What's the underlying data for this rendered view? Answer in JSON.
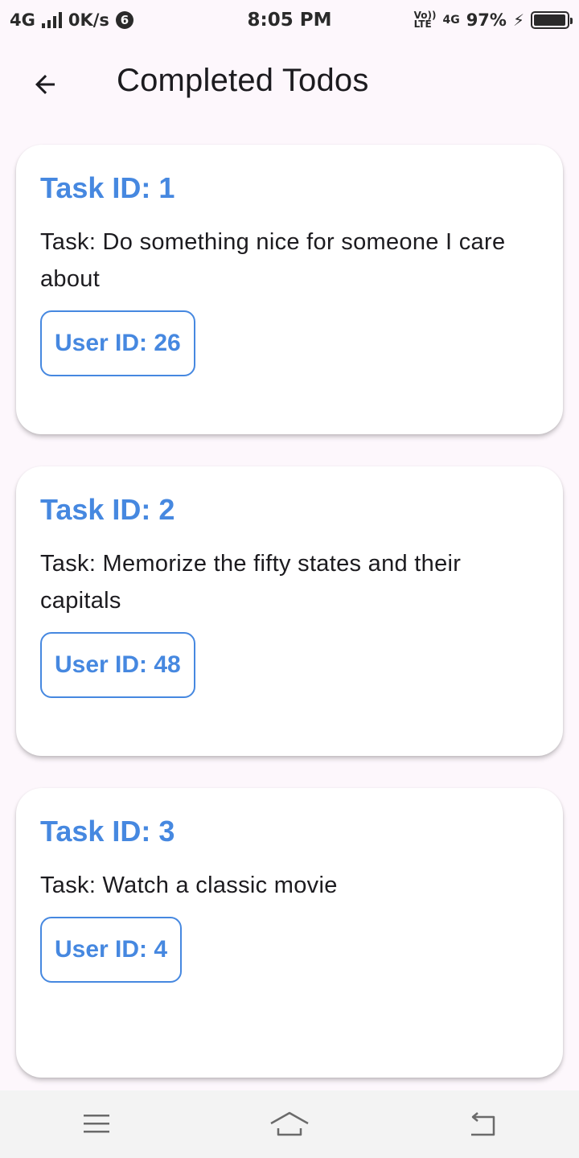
{
  "status_bar": {
    "network": "4G",
    "speed": "0K/s",
    "notification_count": "6",
    "time": "8:05 PM",
    "volte_top": "Vo))",
    "volte_bottom": "LTE",
    "network_right": "4G",
    "battery_text": "97%",
    "battery_level": 0.97
  },
  "app_bar": {
    "title": "Completed Todos",
    "back_icon": "arrow-back-icon"
  },
  "todos": [
    {
      "title": "Task ID: 1",
      "task": "Task: Do something nice for someone I care about",
      "user": "User ID: 26"
    },
    {
      "title": "Task ID: 2",
      "task": "Task: Memorize the fifty states and their capitals",
      "user": "User ID: 48"
    },
    {
      "title": "Task ID: 3",
      "task": "Task: Watch a classic movie",
      "user": "User ID: 4"
    }
  ],
  "nav_bar": {
    "menu_icon": "menu-icon",
    "home_icon": "home-icon",
    "back_icon": "back-icon"
  },
  "colors": {
    "accent": "#4688e0",
    "background": "#fdf7fc",
    "card": "#ffffff"
  }
}
